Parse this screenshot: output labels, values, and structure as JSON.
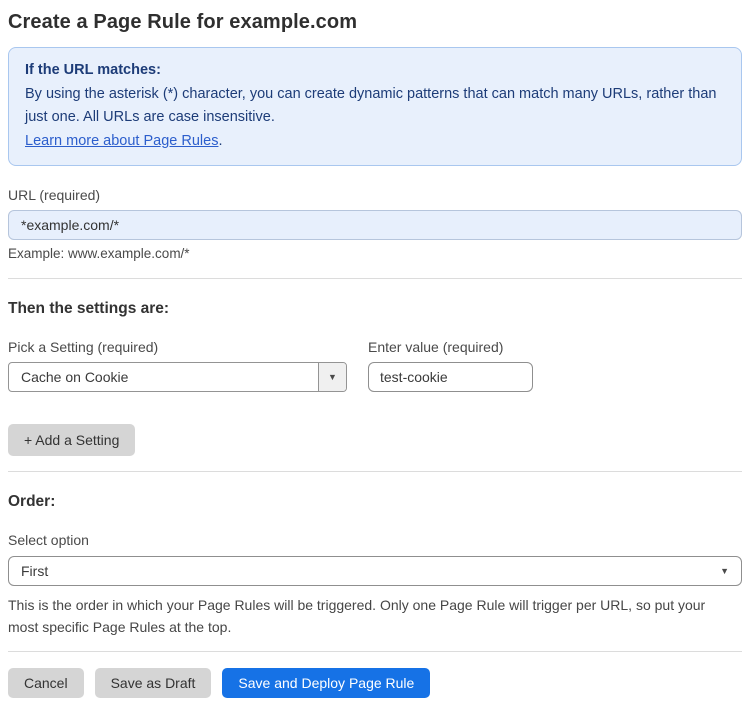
{
  "page": {
    "title": "Create a Page Rule for example.com"
  },
  "info_box": {
    "heading": "If the URL matches:",
    "body": "By using the asterisk (*) character, you can create dynamic patterns that can match many URLs, rather than just one. All URLs are case insensitive.",
    "link_label": "Learn more about Page Rules",
    "link_suffix": "."
  },
  "url_field": {
    "label": "URL (required)",
    "value": "*example.com/*",
    "helper": "Example: www.example.com/*"
  },
  "settings": {
    "heading": "Then the settings are:",
    "setting_label": "Pick a Setting (required)",
    "setting_selected": "Cache on Cookie",
    "value_label": "Enter value (required)",
    "value_text": "test-cookie",
    "add_button_label": "+ Add a Setting"
  },
  "order": {
    "heading": "Order:",
    "select_label": "Select option",
    "selected_option": "First",
    "helper": "This is the order in which your Page Rules will be triggered. Only one Page Rule will trigger per URL, so put your most specific Page Rules at the top."
  },
  "actions": {
    "cancel": "Cancel",
    "save_draft": "Save as Draft",
    "save_deploy": "Save and Deploy Page Rule"
  },
  "icons": {
    "dropdown_caret": "▼"
  },
  "colors": {
    "primary_button_blue": "#1672e6",
    "info_box_background": "#e8f0fc",
    "info_box_border": "#a9c7ef",
    "info_box_text": "#1d3c78",
    "link_blue": "#2c5ecc",
    "url_input_background": "#e7effc",
    "gray_button_background": "#d5d5d5"
  }
}
